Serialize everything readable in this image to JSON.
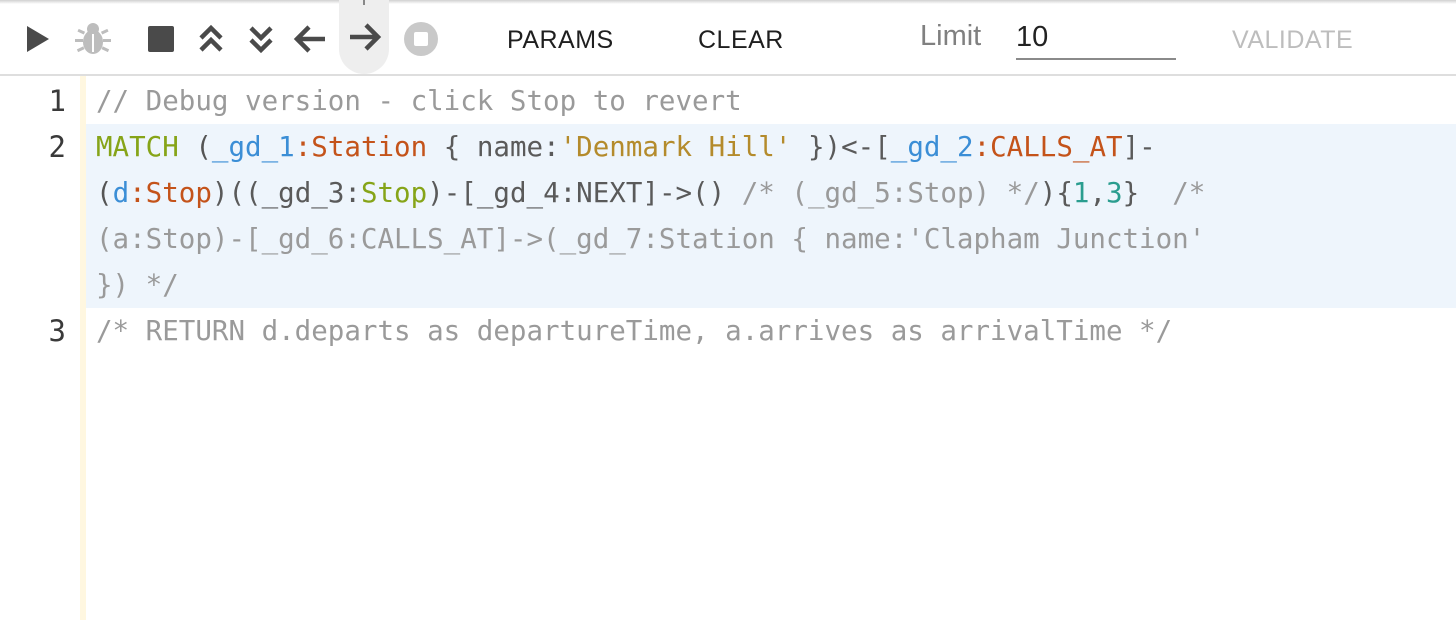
{
  "toolbar": {
    "icons": {
      "run": "play-icon",
      "debug": "bug-icon",
      "stop": "stop-icon",
      "collapse": "double-chevron-up-icon",
      "expand": "double-chevron-down-icon",
      "back": "arrow-left-icon",
      "forward": "arrow-right-icon",
      "cancel": "stop-circle-icon"
    },
    "params_label": "PARAMS",
    "clear_label": "CLEAR",
    "limit_label": "Limit",
    "limit_value": "10",
    "validate_label": "VALIDATE"
  },
  "editor": {
    "line_numbers": [
      "1",
      "2",
      "3"
    ],
    "line1": "// Debug version - click Stop to revert",
    "line2": {
      "t01": "MATCH",
      "t02": " (",
      "t03": "_gd_1",
      "t04": ":Station",
      "t05": " { name:",
      "t06": "'Denmark Hill'",
      "t07": " })<-[",
      "t08": "_gd_2",
      "t09": ":CALLS_AT",
      "t10": "]-",
      "t11": "(",
      "t12": "d",
      "t13": ":Stop",
      "t14": ")((_gd_3:",
      "t15": "Stop",
      "t16": ")-[_gd_4:NEXT]->() ",
      "t17": "/* (_gd_5:Stop) */",
      "t18": "){",
      "t19": "1",
      "t20": ",",
      "t21": "3",
      "t22": "}  ",
      "t23": "/*",
      "t24": "(a:Stop)-[_gd_6:CALLS_AT]->(_gd_7:Station { name:'Clapham Junction'",
      "t25": "}) */"
    },
    "line3": "/* RETURN d.departs as departureTime, a.arrives as arrivalTime */"
  },
  "colors": {
    "keyword": "#86a418",
    "variable": "#3b8ed6",
    "label": "#c4531a",
    "string": "#b48b2c",
    "number": "#2a9d8f",
    "comment": "#9a9a9a",
    "active_line": "#eef5fc",
    "gutter_border": "#fff7e0"
  }
}
